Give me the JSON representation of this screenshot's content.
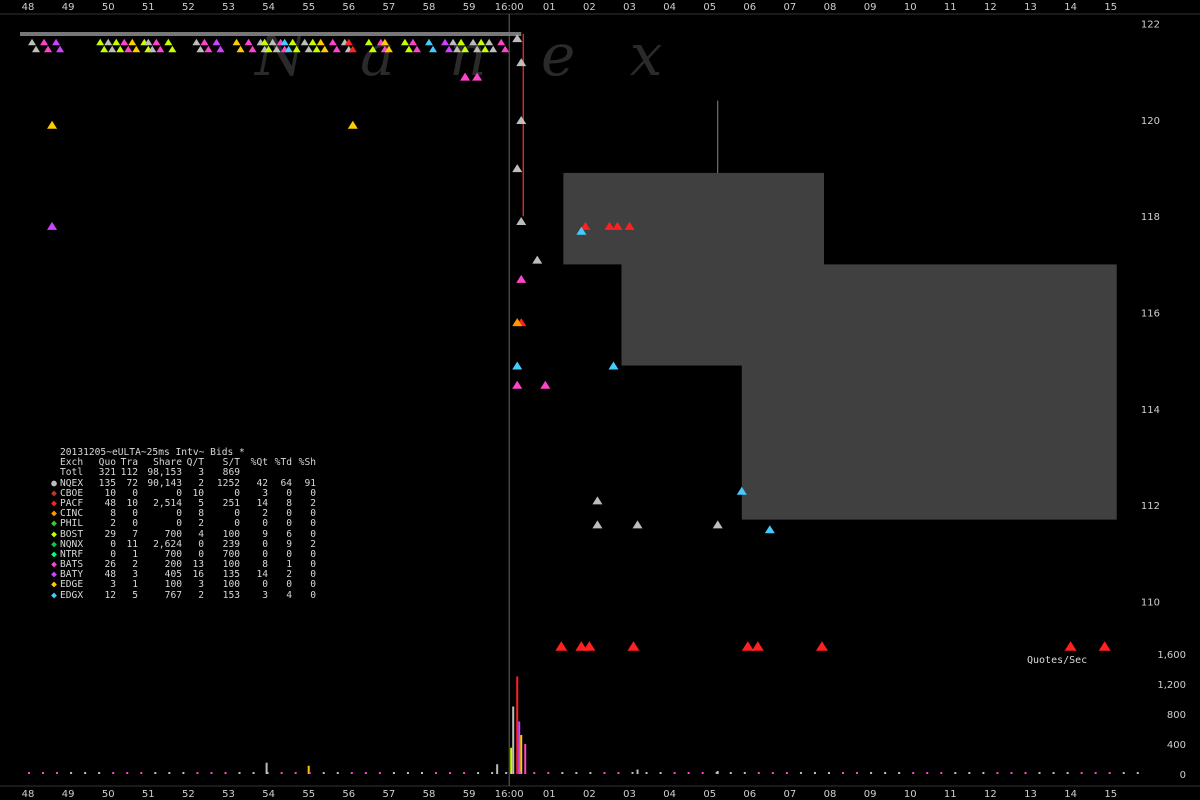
{
  "chart_data": {
    "type": "scatter",
    "title": "20131205~eULTA~25ms Intv~ Bids *",
    "watermark": "N a n e x",
    "x_ticks": [
      "48",
      "49",
      "50",
      "51",
      "52",
      "53",
      "54",
      "55",
      "56",
      "57",
      "58",
      "59",
      "16:00",
      "01",
      "02",
      "03",
      "04",
      "05",
      "06",
      "07",
      "08",
      "09",
      "10",
      "11",
      "12",
      "13",
      "14",
      "15"
    ],
    "price_axis": {
      "ticks": [
        "122",
        "120",
        "118",
        "116",
        "114",
        "112",
        "110"
      ],
      "ylim": [
        109.2,
        122.2
      ]
    },
    "rate_axis": {
      "label": "Quotes/Sec",
      "ticks": [
        "1,600",
        "1,200",
        "800",
        "400",
        "0"
      ],
      "ylim": [
        0,
        1600
      ]
    },
    "colors": {
      "NQEX": "#bdbdbd",
      "CBOE": "#c0392b",
      "PACF": "#ff2020",
      "CINC": "#ff9900",
      "PHIL": "#33cc33",
      "BOST": "#c8ff00",
      "NQNX": "#00cc44",
      "NTRF": "#00ff88",
      "BATS": "#ff44cc",
      "BATY": "#cc44ff",
      "EDGE": "#ffcc00",
      "EDGX": "#44ccff",
      "nbb_fill": "#404040",
      "marker_line": "#ff3333"
    },
    "nbb_regions": [
      {
        "x0": 13.35,
        "x1": 19.85,
        "y0": 117.0,
        "y1": 118.9
      },
      {
        "x0": 14.8,
        "x1": 19.85,
        "y0": 114.9,
        "y1": 117.1
      },
      {
        "x0": 19.85,
        "x1": 27.15,
        "y0": 111.7,
        "y1": 117.0
      },
      {
        "x0": 17.8,
        "x1": 19.85,
        "y0": 111.7,
        "y1": 115.0
      }
    ],
    "quotes": [
      {
        "ex": "EDGE",
        "t": 0.6,
        "p": 119.9
      },
      {
        "ex": "EDGE",
        "t": 8.1,
        "p": 119.9
      },
      {
        "ex": "BATY",
        "t": 0.6,
        "p": 117.8
      },
      {
        "ex": "BATS",
        "t": 10.9,
        "p": 120.9
      },
      {
        "ex": "BATS",
        "t": 11.2,
        "p": 120.9
      },
      {
        "ex": "NQEX",
        "t": 12.2,
        "p": 121.7
      },
      {
        "ex": "NQEX",
        "t": 12.3,
        "p": 121.2
      },
      {
        "ex": "NQEX",
        "t": 12.3,
        "p": 120.0
      },
      {
        "ex": "NQEX",
        "t": 12.2,
        "p": 119.0
      },
      {
        "ex": "NQEX",
        "t": 12.3,
        "p": 117.9
      },
      {
        "ex": "NQEX",
        "t": 12.7,
        "p": 117.1
      },
      {
        "ex": "NQEX",
        "t": 14.2,
        "p": 112.1
      },
      {
        "ex": "NQEX",
        "t": 14.2,
        "p": 111.6
      },
      {
        "ex": "NQEX",
        "t": 15.2,
        "p": 111.6
      },
      {
        "ex": "NQEX",
        "t": 17.2,
        "p": 111.6
      },
      {
        "ex": "BATS",
        "t": 12.3,
        "p": 116.7
      },
      {
        "ex": "BATS",
        "t": 12.2,
        "p": 114.5
      },
      {
        "ex": "BATS",
        "t": 12.9,
        "p": 114.5
      },
      {
        "ex": "PACF",
        "t": 12.3,
        "p": 115.8
      },
      {
        "ex": "CINC",
        "t": 12.2,
        "p": 115.8
      },
      {
        "ex": "EDGX",
        "t": 12.2,
        "p": 114.9
      },
      {
        "ex": "EDGX",
        "t": 14.6,
        "p": 114.9
      },
      {
        "ex": "EDGX",
        "t": 17.8,
        "p": 112.3
      },
      {
        "ex": "EDGX",
        "t": 18.5,
        "p": 111.5
      },
      {
        "ex": "PACF",
        "t": 14.5,
        "p": 117.8
      },
      {
        "ex": "PACF",
        "t": 14.7,
        "p": 117.8
      },
      {
        "ex": "PACF",
        "t": 15.0,
        "p": 117.8
      },
      {
        "ex": "PACF",
        "t": 13.9,
        "p": 117.8
      },
      {
        "ex": "EDGX",
        "t": 13.8,
        "p": 117.7
      }
    ],
    "top_band": [
      {
        "ex": "NQEX",
        "t": 0.1
      },
      {
        "ex": "BATS",
        "t": 0.4
      },
      {
        "ex": "BATY",
        "t": 0.7
      },
      {
        "ex": "BOST",
        "t": 1.8
      },
      {
        "ex": "NQEX",
        "t": 2.0
      },
      {
        "ex": "BOST",
        "t": 2.2
      },
      {
        "ex": "BATS",
        "t": 2.4
      },
      {
        "ex": "EDGE",
        "t": 2.6
      },
      {
        "ex": "BOST",
        "t": 2.9
      },
      {
        "ex": "NQEX",
        "t": 3.0
      },
      {
        "ex": "BATS",
        "t": 3.2
      },
      {
        "ex": "BOST",
        "t": 3.5
      },
      {
        "ex": "NQEX",
        "t": 4.2
      },
      {
        "ex": "BATS",
        "t": 4.4
      },
      {
        "ex": "BATY",
        "t": 4.7
      },
      {
        "ex": "EDGE",
        "t": 5.2
      },
      {
        "ex": "BATS",
        "t": 5.5
      },
      {
        "ex": "NQEX",
        "t": 5.8
      },
      {
        "ex": "BOST",
        "t": 5.9
      },
      {
        "ex": "NQEX",
        "t": 6.1
      },
      {
        "ex": "BATS",
        "t": 6.3
      },
      {
        "ex": "EDGX",
        "t": 6.4
      },
      {
        "ex": "BOST",
        "t": 6.6
      },
      {
        "ex": "NQEX",
        "t": 6.9
      },
      {
        "ex": "BOST",
        "t": 7.1
      },
      {
        "ex": "EDGE",
        "t": 7.3
      },
      {
        "ex": "BATS",
        "t": 7.6
      },
      {
        "ex": "NQEX",
        "t": 7.9
      },
      {
        "ex": "PACF",
        "t": 8.0
      },
      {
        "ex": "BOST",
        "t": 8.5
      },
      {
        "ex": "BATS",
        "t": 8.8
      },
      {
        "ex": "EDGE",
        "t": 8.9
      },
      {
        "ex": "BOST",
        "t": 9.4
      },
      {
        "ex": "BATS",
        "t": 9.6
      },
      {
        "ex": "EDGX",
        "t": 10.0
      },
      {
        "ex": "BATY",
        "t": 10.4
      },
      {
        "ex": "NQEX",
        "t": 10.6
      },
      {
        "ex": "BOST",
        "t": 10.8
      },
      {
        "ex": "NQEX",
        "t": 11.1
      },
      {
        "ex": "BOST",
        "t": 11.3
      },
      {
        "ex": "NQEX",
        "t": 11.5
      },
      {
        "ex": "BATS",
        "t": 11.8
      }
    ],
    "rate_bars": [
      {
        "ex": "NQEX",
        "t": 12.1,
        "v": 900
      },
      {
        "ex": "PACF",
        "t": 12.2,
        "v": 1300
      },
      {
        "ex": "BATY",
        "t": 12.25,
        "v": 700
      },
      {
        "ex": "EDGE",
        "t": 12.3,
        "v": 520
      },
      {
        "ex": "BOST",
        "t": 12.05,
        "v": 350
      },
      {
        "ex": "BATS",
        "t": 12.4,
        "v": 400
      },
      {
        "ex": "NQEX",
        "t": 5.95,
        "v": 150
      },
      {
        "ex": "NQEX",
        "t": 11.7,
        "v": 130
      },
      {
        "ex": "EDGE",
        "t": 7.0,
        "v": 110
      },
      {
        "ex": "NQEX",
        "t": 15.2,
        "v": 60
      },
      {
        "ex": "NQEX",
        "t": 17.2,
        "v": 40
      }
    ],
    "nbb_markers": [
      13.3,
      13.8,
      14.0,
      15.1,
      17.95,
      18.2,
      19.8,
      26.0,
      26.85
    ],
    "legend": {
      "headers": [
        "Exch",
        "Quo",
        "Tra",
        "Share",
        "Q/T",
        "S/T",
        "%Qt",
        "%Td",
        "%Sh"
      ],
      "rows": [
        [
          "Totl",
          "321",
          "112",
          "98,153",
          "3",
          "869",
          "",
          "",
          ""
        ],
        [
          "NQEX",
          "135",
          "72",
          "90,143",
          "2",
          "1252",
          "42",
          "64",
          "91"
        ],
        [
          "CBOE",
          "10",
          "0",
          "0",
          "10",
          "0",
          "3",
          "0",
          "0"
        ],
        [
          "PACF",
          "48",
          "10",
          "2,514",
          "5",
          "251",
          "14",
          "8",
          "2"
        ],
        [
          "CINC",
          "8",
          "0",
          "0",
          "8",
          "0",
          "2",
          "0",
          "0"
        ],
        [
          "PHIL",
          "2",
          "0",
          "0",
          "2",
          "0",
          "0",
          "0",
          "0"
        ],
        [
          "BOST",
          "29",
          "7",
          "700",
          "4",
          "100",
          "9",
          "6",
          "0"
        ],
        [
          "NQNX",
          "0",
          "11",
          "2,624",
          "0",
          "239",
          "0",
          "9",
          "2"
        ],
        [
          "NTRF",
          "0",
          "1",
          "700",
          "0",
          "700",
          "0",
          "0",
          "0"
        ],
        [
          "BATS",
          "26",
          "2",
          "200",
          "13",
          "100",
          "8",
          "1",
          "0"
        ],
        [
          "BATY",
          "48",
          "3",
          "405",
          "16",
          "135",
          "14",
          "2",
          "0"
        ],
        [
          "EDGE",
          "3",
          "1",
          "100",
          "3",
          "100",
          "0",
          "0",
          "0"
        ],
        [
          "EDGX",
          "12",
          "5",
          "767",
          "2",
          "153",
          "3",
          "4",
          "0"
        ]
      ]
    }
  }
}
